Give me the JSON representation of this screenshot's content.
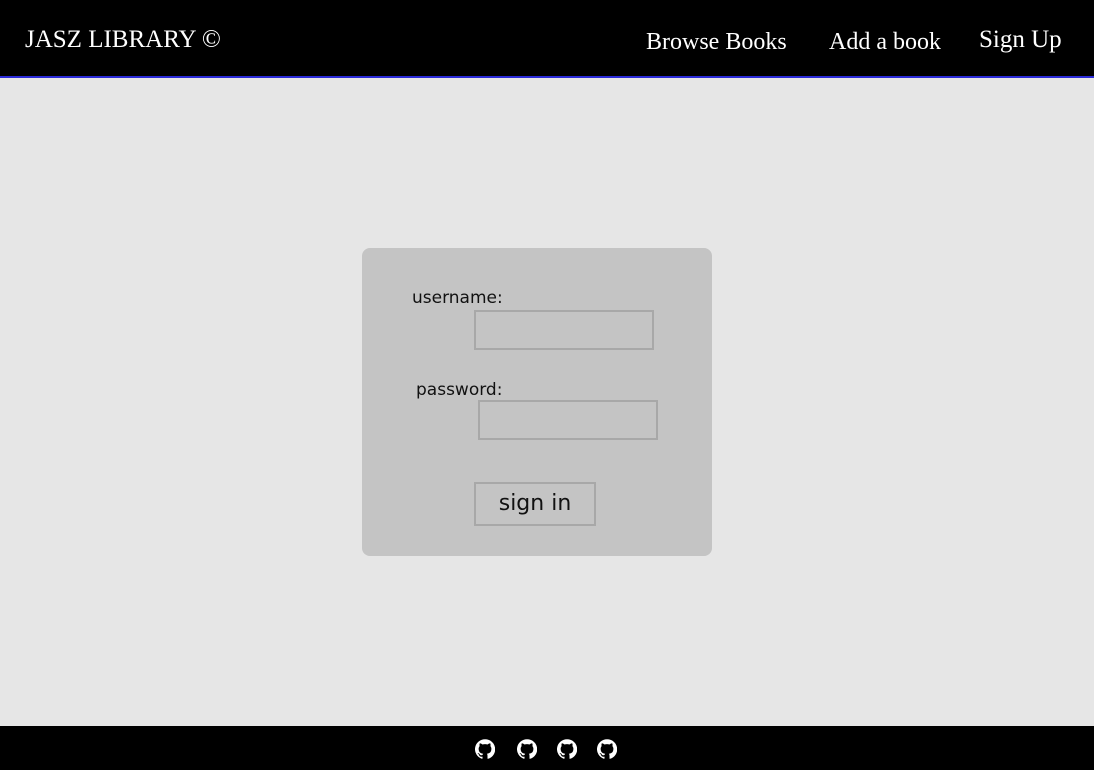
{
  "header": {
    "brand": "JASZ LIBRARY ©",
    "nav": {
      "browse_books": "Browse Books",
      "add_a_book": "Add a book",
      "sign_up": "Sign Up"
    }
  },
  "login": {
    "username_label": "username:",
    "username_value": "",
    "password_label": "password:",
    "password_value": "",
    "submit_label": "sign in"
  },
  "footer": {
    "links": [
      {
        "icon": "github-icon"
      },
      {
        "icon": "github-icon"
      },
      {
        "icon": "github-icon"
      },
      {
        "icon": "github-icon"
      }
    ]
  },
  "colors": {
    "header_bg": "#000000",
    "header_border": "#2b2bd9",
    "page_bg": "#e6e6e6",
    "card_bg": "#c4c4c4",
    "field_border": "#a8a8a8",
    "footer_bg": "#000000"
  }
}
